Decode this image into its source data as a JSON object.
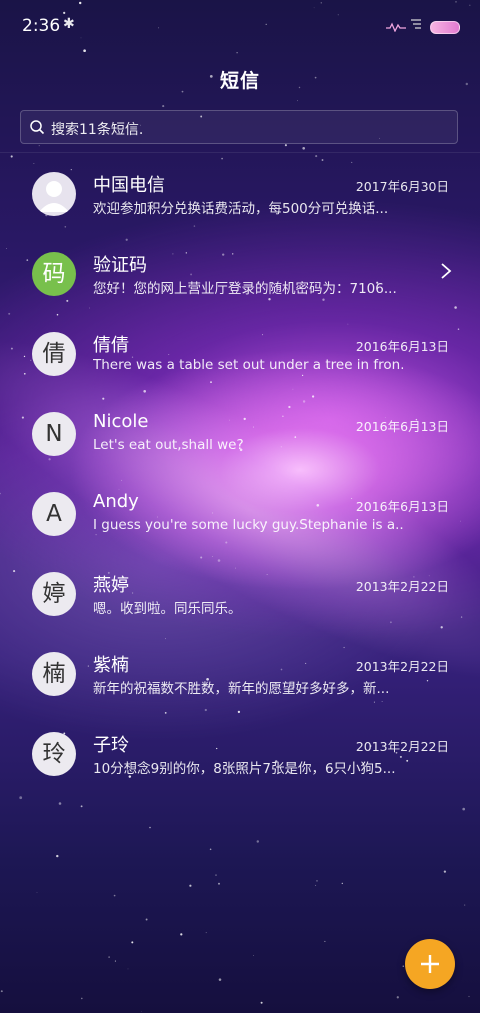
{
  "status_bar": {
    "time": "2:36",
    "bluetooth_icon": "bluetooth-icon",
    "signal_icon": "signal-icon",
    "wifi_icon": "wifi-icon",
    "battery_icon": "battery-icon"
  },
  "header": {
    "title": "短信"
  },
  "search": {
    "placeholder": "搜索11条短信."
  },
  "conversations": [
    {
      "avatar_type": "person",
      "avatar_text": "",
      "name": "中国电信",
      "date": "2017年6月30日",
      "preview": "欢迎参加积分兑换话费活动，每500分可兑换话..."
    },
    {
      "avatar_type": "green",
      "avatar_text": "码",
      "name": "验证码",
      "date": "",
      "preview": "您好！您的网上营业厅登录的随机密码为：7106...",
      "folder": true
    },
    {
      "avatar_type": "letter",
      "avatar_text": "倩",
      "name": "倩倩",
      "date": "2016年6月13日",
      "preview": "There was a table set out under a tree in fron..."
    },
    {
      "avatar_type": "letter",
      "avatar_text": "N",
      "name": "Nicole",
      "date": "2016年6月13日",
      "preview": "Let's eat out,shall we?"
    },
    {
      "avatar_type": "letter",
      "avatar_text": "A",
      "name": "Andy",
      "date": "2016年6月13日",
      "preview": "I guess you're some lucky guy.Stephanie is a..."
    },
    {
      "avatar_type": "letter",
      "avatar_text": "婷",
      "name": "燕婷",
      "date": "2013年2月22日",
      "preview": "嗯。收到啦。同乐同乐。"
    },
    {
      "avatar_type": "letter",
      "avatar_text": "楠",
      "name": "紫楠",
      "date": "2013年2月22日",
      "preview": "新年的祝福数不胜数，新年的愿望好多好多，新..."
    },
    {
      "avatar_type": "letter",
      "avatar_text": "玲",
      "name": "子玲",
      "date": "2013年2月22日",
      "preview": "10分想念9别的你，8张照片7张是你，6只小狗5..."
    }
  ],
  "fab": {
    "icon": "plus-icon",
    "color": "#f5a623"
  }
}
